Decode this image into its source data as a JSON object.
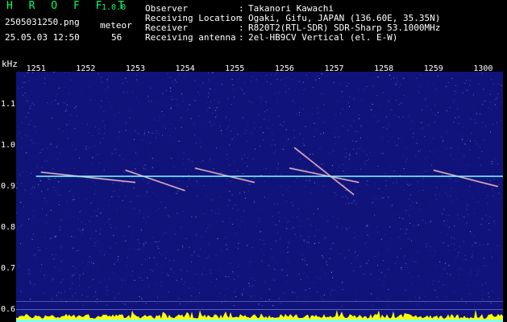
{
  "header": {
    "app_title": "H R O F F T",
    "app_version": "1.0.0",
    "file_name": "2505031250.png",
    "meteor_label": "meteor",
    "datetime": "25.05.03 12:50",
    "meteor_count": "56"
  },
  "info": [
    {
      "label": "Observer",
      "value": "Takanori Kawachi"
    },
    {
      "label": "Receiving Location",
      "value": "Ogaki, Gifu, JAPAN (136.60E, 35.35N)"
    },
    {
      "label": "Receiver",
      "value": "R820T2(RTL-SDR) SDR-Sharp 53.1000MHz"
    },
    {
      "label": "Receiving antenna",
      "value": "2el-HB9CV Vertical (el. E-W)"
    }
  ],
  "chart_data": {
    "type": "heatmap",
    "ylabel": "kHz",
    "y_ticks": [
      "1.1",
      "1.0",
      "0.9",
      "0.8",
      "0.7",
      "0.6"
    ],
    "x_ticks": [
      "1251",
      "1252",
      "1253",
      "1254",
      "1255",
      "1256",
      "1257",
      "1258",
      "1259",
      "1300"
    ],
    "ylim": [
      0.57,
      1.18
    ],
    "xlim": [
      1250.6,
      1300.4
    ],
    "carrier_khz": 0.925,
    "background_color": "#10147a",
    "carrier_color": "#7fffff",
    "baseline_color": "#ffff00",
    "meteor_echoes": [
      {
        "start_min": 1251.1,
        "end_min": 1253.0,
        "f_start": 0.935,
        "f_end": 0.91
      },
      {
        "start_min": 1252.8,
        "end_min": 1254.0,
        "f_start": 0.94,
        "f_end": 0.89
      },
      {
        "start_min": 1254.2,
        "end_min": 1255.4,
        "f_start": 0.945,
        "f_end": 0.91
      },
      {
        "start_min": 1256.1,
        "end_min": 1257.5,
        "f_start": 0.945,
        "f_end": 0.91
      },
      {
        "start_min": 1259.0,
        "end_min": 1300.3,
        "f_start": 0.94,
        "f_end": 0.9
      },
      {
        "start_min": 1256.2,
        "end_min": 1257.4,
        "f_start": 0.995,
        "f_end": 0.88
      }
    ]
  }
}
